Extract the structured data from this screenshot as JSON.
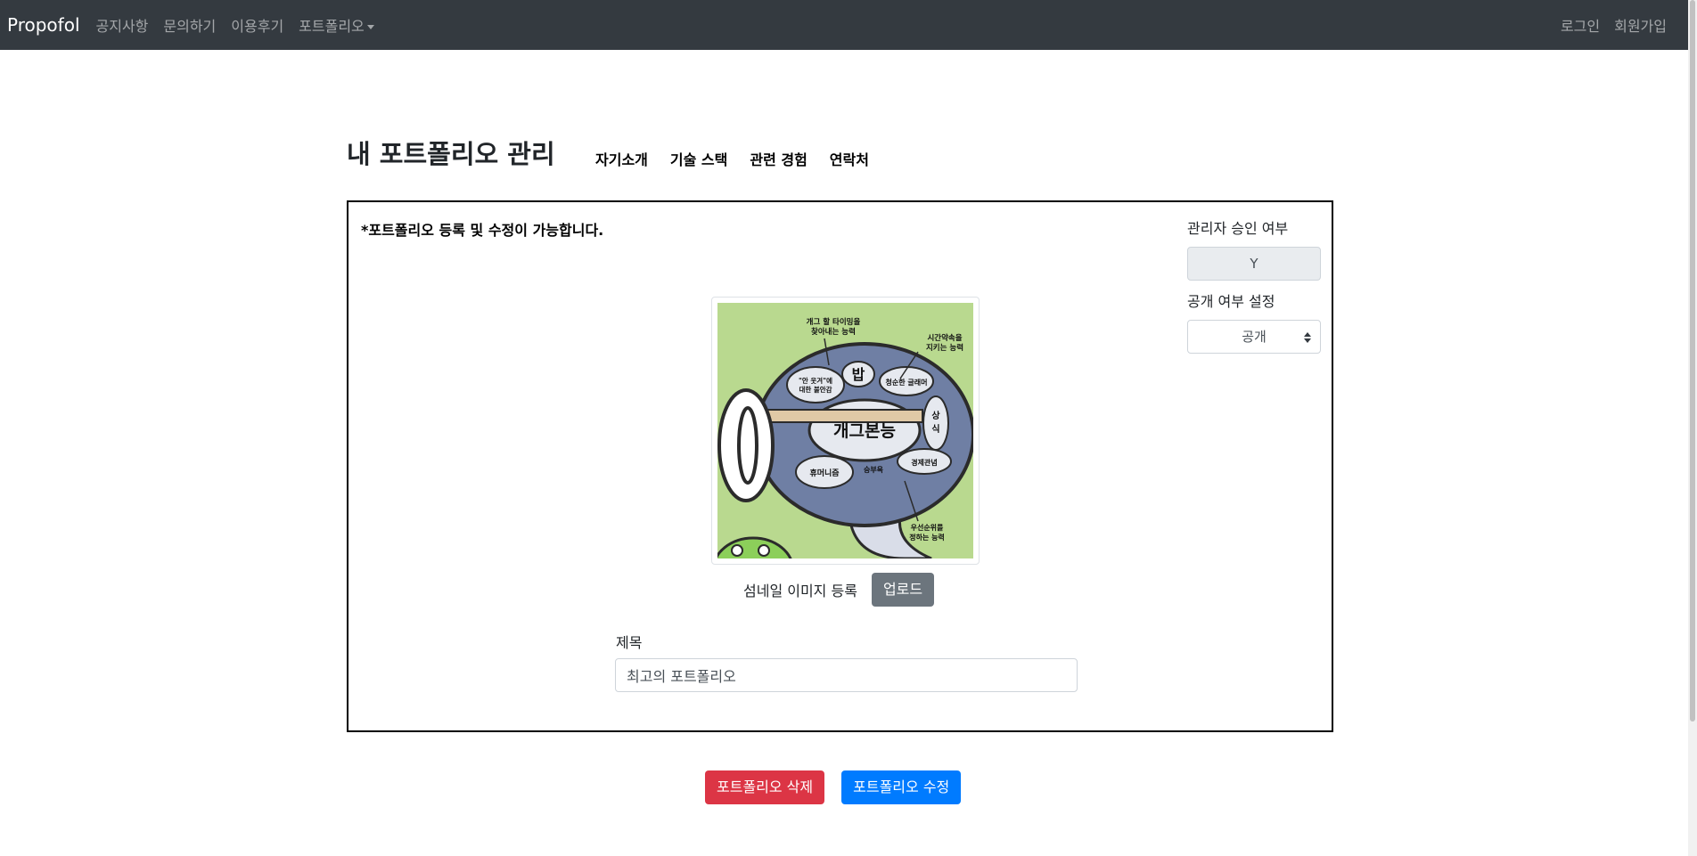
{
  "navbar": {
    "brand": "Propofol",
    "links": [
      "공지사항",
      "문의하기",
      "이용후기",
      "포트폴리오"
    ],
    "right_links": [
      "로그인",
      "회원가입"
    ]
  },
  "page": {
    "title": "내 포트폴리오 관리",
    "subnav": [
      "자기소개",
      "기술 스택",
      "관련 경험",
      "연락처"
    ]
  },
  "panel": {
    "notice": "*포트폴리오 등록 및 수정이 가능합니다.",
    "approval_label": "관리자 승인 여부",
    "approval_value": "Y",
    "public_label": "공개 여부 설정",
    "public_value": "공개",
    "thumbnail": {
      "label": "섬네일 이미지 등록",
      "upload_button": "업로드",
      "caption_texts": [
        "개그 할 타이밍을 찾아내는 능력",
        "시간약속을 지키는 능력",
        "밥",
        "청순한 글래머",
        "\"안 웃겨\"에 대한 불안감",
        "개그본능",
        "휴머니즘",
        "승부욕",
        "경제관념",
        "상식",
        "우선순위를 정하는 능력"
      ]
    },
    "title_label": "제목",
    "title_value": "최고의 포트폴리오"
  },
  "actions": {
    "delete": "포트폴리오 삭제",
    "edit": "포트폴리오 수정"
  },
  "colors": {
    "navbar_bg": "#343a40",
    "danger": "#dc3545",
    "primary": "#007bff",
    "secondary": "#6c757d"
  }
}
